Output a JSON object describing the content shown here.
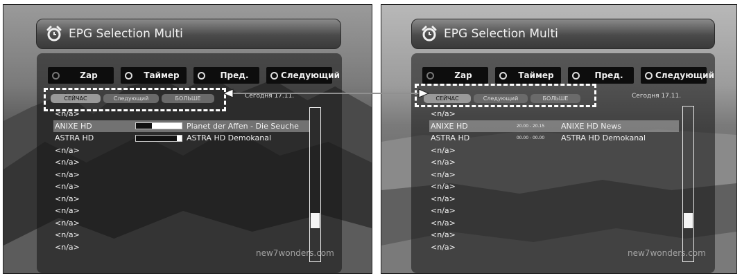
{
  "left": {
    "title": "EPG Selection Multi",
    "buttons": {
      "zap": "Zap",
      "timer": "Таймер",
      "prev": "Пред.",
      "next": "Следующий"
    },
    "tabs": {
      "now": "СЕЙЧАС",
      "next": "Следующий",
      "more": "БОЛЬШЕ"
    },
    "date": "Сегодня 17.11.",
    "rows": [
      {
        "channel": "<n/a>",
        "progress": null,
        "event": ""
      },
      {
        "channel": "ANIXE HD",
        "progress": 0.35,
        "event": "Planet der Affen - Die Seuche"
      },
      {
        "channel": "ASTRA HD",
        "progress": 0.9,
        "event": "ASTRA HD Demokanal"
      },
      {
        "channel": "<n/a>",
        "progress": null,
        "event": ""
      },
      {
        "channel": "<n/a>",
        "progress": null,
        "event": ""
      },
      {
        "channel": "<n/a>",
        "progress": null,
        "event": ""
      },
      {
        "channel": "<n/a>",
        "progress": null,
        "event": ""
      },
      {
        "channel": "<n/a>",
        "progress": null,
        "event": ""
      },
      {
        "channel": "<n/a>",
        "progress": null,
        "event": ""
      },
      {
        "channel": "<n/a>",
        "progress": null,
        "event": ""
      },
      {
        "channel": "<n/a>",
        "progress": null,
        "event": ""
      },
      {
        "channel": "<n/a>",
        "progress": null,
        "event": ""
      }
    ],
    "watermark": "new7wonders.com"
  },
  "right": {
    "title": "EPG Selection Multi",
    "buttons": {
      "zap": "Zap",
      "timer": "Таймер",
      "prev": "Пред.",
      "next": "Следующий"
    },
    "tabs": {
      "now": "СЕЙЧАС",
      "next": "Следующий",
      "more": "БОЛЬШЕ"
    },
    "date": "Сегодня 17.11.",
    "rows": [
      {
        "channel": "<n/a>",
        "time": "",
        "event": ""
      },
      {
        "channel": "ANIXE HD",
        "time": "20.00 - 20.15",
        "event": "ANIXE HD News"
      },
      {
        "channel": "ASTRA HD",
        "time": "00.00 - 00.00",
        "event": "ASTRA HD Demokanal"
      },
      {
        "channel": "<n/a>",
        "time": "",
        "event": ""
      },
      {
        "channel": "<n/a>",
        "time": "",
        "event": ""
      },
      {
        "channel": "<n/a>",
        "time": "",
        "event": ""
      },
      {
        "channel": "<n/a>",
        "time": "",
        "event": ""
      },
      {
        "channel": "<n/a>",
        "time": "",
        "event": ""
      },
      {
        "channel": "<n/a>",
        "time": "",
        "event": ""
      },
      {
        "channel": "<n/a>",
        "time": "",
        "event": ""
      },
      {
        "channel": "<n/a>",
        "time": "",
        "event": ""
      },
      {
        "channel": "<n/a>",
        "time": "",
        "event": ""
      }
    ],
    "watermark": "new7wonders.com"
  },
  "icons": {
    "title": "alarm-clock-icon",
    "button_dot": "radio-circle-icon"
  },
  "colors": {
    "panel": "#1a1a1a",
    "selected_row": "#b4b4b4",
    "button": "#0d0d0d",
    "text": "#f2f2f2"
  }
}
